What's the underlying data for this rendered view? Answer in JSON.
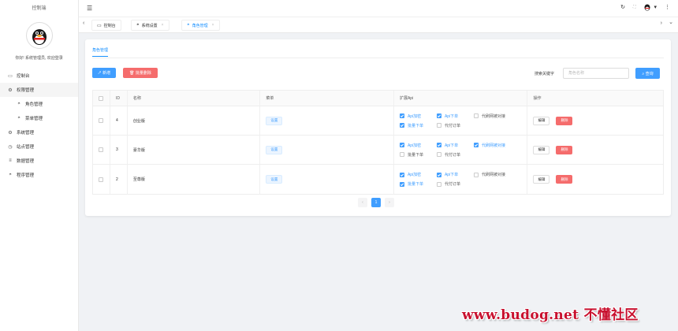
{
  "sidebar": {
    "brand": "控制端",
    "greeting": "你好! 系统管理员, 欢迎登录",
    "items": [
      {
        "label": "控制台",
        "icon": "monitor-icon",
        "glyph": "▭"
      },
      {
        "label": "权限管理",
        "icon": "gear-icon",
        "glyph": "⚙"
      },
      {
        "label": "角色管理",
        "icon": "wifi-icon",
        "glyph": "◓"
      },
      {
        "label": "菜单管理",
        "icon": "wifi-icon",
        "glyph": "◓"
      },
      {
        "label": "系统管理",
        "icon": "gear-icon",
        "glyph": "⚙"
      },
      {
        "label": "站点管理",
        "icon": "clock-icon",
        "glyph": "◷"
      },
      {
        "label": "数据管理",
        "icon": "list-icon",
        "glyph": "≡"
      },
      {
        "label": "程序管理",
        "icon": "wifi-icon",
        "glyph": "◓"
      }
    ]
  },
  "topbar": {
    "fold_glyph": "☰",
    "refresh_glyph": "↻",
    "fullscreen_glyph": "⛶",
    "avatar_caret": "▾",
    "more_glyph": "⋮"
  },
  "tabs": {
    "left_arrow": "‹",
    "right_arrow": "›",
    "down_arrow": "⌄",
    "items": [
      {
        "label": "控制台",
        "glyph": "▭"
      },
      {
        "label": "系统设置",
        "glyph": "◓",
        "close": "×"
      },
      {
        "label": "角色管理",
        "glyph": "◓",
        "close": "×"
      }
    ]
  },
  "card": {
    "tab_label": "角色管理",
    "add_label": "↗ 新增",
    "batch_delete_label": "🗑 批量删除",
    "search_label": "搜索关键字",
    "search_placeholder": "角色名称",
    "search_button": "⌕ 查询"
  },
  "table": {
    "headers": {
      "id": "ID",
      "name": "名称",
      "menu": "菜单",
      "api": "扩展Api",
      "ops": "操作"
    },
    "set_label": "设置",
    "edit_label": "编辑",
    "delete_label": "删除",
    "api_options": [
      "Api加密",
      "Api下单",
      "代刷网被对接",
      "批量下单",
      "代付订单"
    ],
    "rows": [
      {
        "id": "4",
        "name": "创业版",
        "api_checked": [
          true,
          true,
          false,
          true,
          false
        ]
      },
      {
        "id": "3",
        "name": "豪华版",
        "api_checked": [
          true,
          true,
          true,
          false,
          false
        ]
      },
      {
        "id": "2",
        "name": "至尊版",
        "api_checked": [
          true,
          true,
          false,
          true,
          false
        ]
      }
    ]
  },
  "pagination": {
    "prev": "‹",
    "current": "1",
    "next": "›"
  },
  "watermark": "www.budog.net 不懂社区",
  "colors": {
    "primary": "#409eff",
    "danger": "#f56c6c",
    "tab_active": "#1890ff",
    "watermark": "#c8102e"
  }
}
